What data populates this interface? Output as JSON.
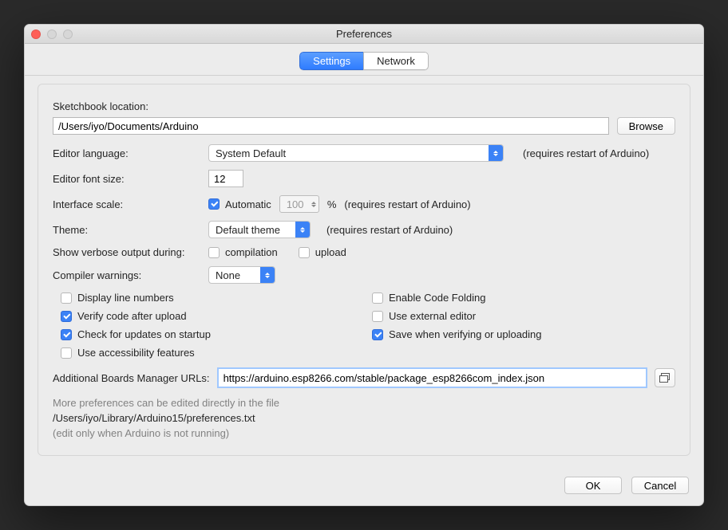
{
  "window": {
    "title": "Preferences"
  },
  "tabs": {
    "settings": "Settings",
    "network": "Network"
  },
  "sketchbook": {
    "label": "Sketchbook location:",
    "path": "/Users/iyo/Documents/Arduino",
    "browse": "Browse"
  },
  "editor_language": {
    "label": "Editor language:",
    "value": "System Default",
    "hint": "(requires restart of Arduino)"
  },
  "font_size": {
    "label": "Editor font size:",
    "value": "12"
  },
  "interface_scale": {
    "label": "Interface scale:",
    "automatic": "Automatic",
    "value": "100",
    "unit": "%",
    "hint": "(requires restart of Arduino)"
  },
  "theme": {
    "label": "Theme:",
    "value": "Default theme",
    "hint": "(requires restart of Arduino)"
  },
  "verbose": {
    "label": "Show verbose output during:",
    "compilation": "compilation",
    "upload": "upload"
  },
  "compiler_warnings": {
    "label": "Compiler warnings:",
    "value": "None"
  },
  "checkboxes": {
    "display_line_numbers": "Display line numbers",
    "enable_code_folding": "Enable Code Folding",
    "verify_after_upload": "Verify code after upload",
    "external_editor": "Use external editor",
    "check_updates": "Check for updates on startup",
    "save_when_verifying": "Save when verifying or uploading",
    "accessibility": "Use accessibility features"
  },
  "boards_url": {
    "label": "Additional Boards Manager URLs:",
    "value": "https://arduino.esp8266.com/stable/package_esp8266com_index.json"
  },
  "footer": {
    "line1": "More preferences can be edited directly in the file",
    "line2": "/Users/iyo/Library/Arduino15/preferences.txt",
    "line3": "(edit only when Arduino is not running)"
  },
  "buttons": {
    "ok": "OK",
    "cancel": "Cancel"
  }
}
